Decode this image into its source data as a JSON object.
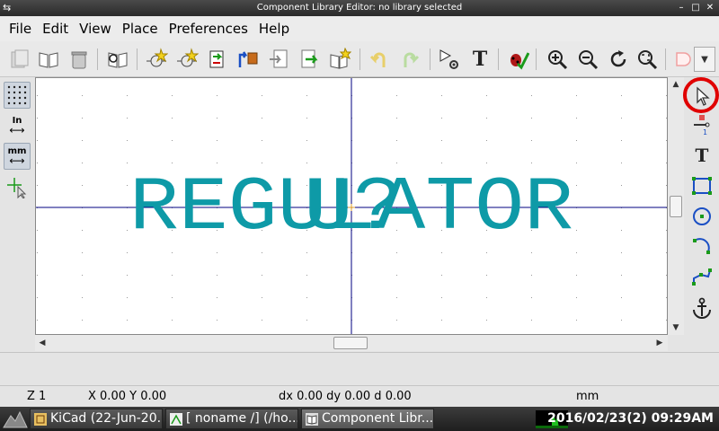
{
  "window": {
    "title": "Component Library Editor: no library selected"
  },
  "menu": {
    "file": "File",
    "edit": "Edit",
    "view": "View",
    "place": "Place",
    "preferences": "Preferences",
    "help": "Help"
  },
  "toolbar": {
    "text_tool_label": "T"
  },
  "left_toolbar": {
    "inch_label": "In",
    "mm_label": "mm"
  },
  "canvas": {
    "field_reference": "U?",
    "field_value": "REGULATOR",
    "colors": {
      "field": "#0e9aa7",
      "axis": "#000080",
      "grid": "#999999",
      "background": "#ffffff"
    }
  },
  "right_toolbar": {
    "text_label": "T"
  },
  "status": {
    "zoom": "Z 1",
    "coords": "X 0.00  Y 0.00",
    "delta": "dx 0.00  dy 0.00  d 0.00",
    "units": "mm"
  },
  "taskbar": {
    "tasks": [
      "KiCad (22-Jun-20...",
      "[ noname /] (/ho...",
      "Component Libr..."
    ],
    "clock": "2016/02/23(2) 09:29AM"
  },
  "colors": {
    "highlight_ring": "#e00000",
    "accent_blue": "#1a4fc4"
  }
}
